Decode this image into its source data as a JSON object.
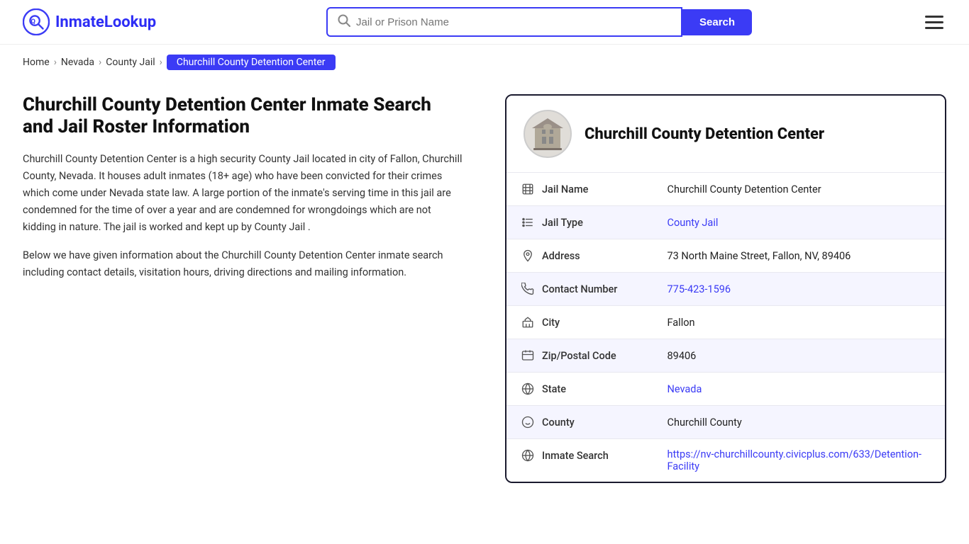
{
  "header": {
    "logo_text": "InmateLookup",
    "search_placeholder": "Jail or Prison Name",
    "search_button_label": "Search"
  },
  "breadcrumb": {
    "items": [
      {
        "label": "Home",
        "href": "#"
      },
      {
        "label": "Nevada",
        "href": "#"
      },
      {
        "label": "County Jail",
        "href": "#"
      },
      {
        "label": "Churchill County Detention Center",
        "current": true
      }
    ]
  },
  "left": {
    "heading": "Churchill County Detention Center Inmate Search and Jail Roster Information",
    "paragraph1": "Churchill County Detention Center is a high security County Jail located in city of Fallon, Churchill County, Nevada. It houses adult inmates (18+ age) who have been convicted for their crimes which come under Nevada state law. A large portion of the inmate's serving time in this jail are condemned for the time of over a year and are condemned for wrongdoings which are not kidding in nature. The jail is worked and kept up by County Jail .",
    "paragraph2": "Below we have given information about the Churchill County Detention Center inmate search including contact details, visitation hours, driving directions and mailing information."
  },
  "card": {
    "title": "Churchill County Detention Center",
    "rows": [
      {
        "label": "Jail Name",
        "value": "Churchill County Detention Center",
        "link": false,
        "icon": "jail-icon"
      },
      {
        "label": "Jail Type",
        "value": "County Jail",
        "link": true,
        "href": "#",
        "icon": "list-icon"
      },
      {
        "label": "Address",
        "value": "73 North Maine Street, Fallon, NV, 89406",
        "link": false,
        "icon": "location-icon"
      },
      {
        "label": "Contact Number",
        "value": "775-423-1596",
        "link": true,
        "href": "tel:775-423-1596",
        "icon": "phone-icon"
      },
      {
        "label": "City",
        "value": "Fallon",
        "link": false,
        "icon": "city-icon"
      },
      {
        "label": "Zip/Postal Code",
        "value": "89406",
        "link": false,
        "icon": "zip-icon"
      },
      {
        "label": "State",
        "value": "Nevada",
        "link": true,
        "href": "#",
        "icon": "state-icon"
      },
      {
        "label": "County",
        "value": "Churchill County",
        "link": false,
        "icon": "county-icon"
      },
      {
        "label": "Inmate Search",
        "value": "https://nv-churchillcounty.civicplus.com/633/Detention-Facility",
        "link": true,
        "href": "https://nv-churchillcounty.civicplus.com/633/Detention-Facility",
        "display": "https://nv-churchillcounty.civicplus.com/633/Detention-\nFacility",
        "icon": "globe-icon"
      }
    ]
  }
}
